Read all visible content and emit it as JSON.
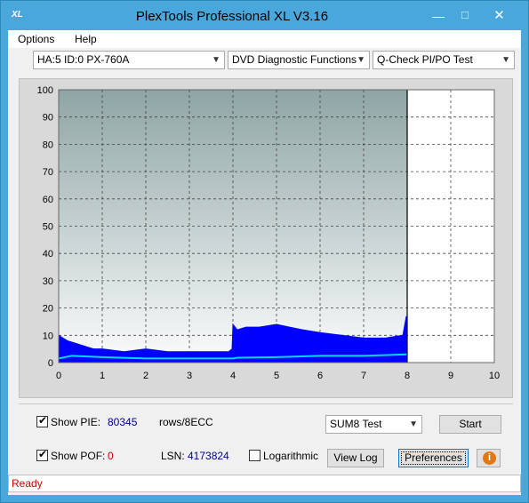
{
  "window": {
    "title": "PlexTools Professional XL V3.16",
    "app_icon_text": "XL",
    "controls": {
      "minimize": "—",
      "maximize": "☐",
      "close": "✕"
    }
  },
  "menu": {
    "options": "Options",
    "help": "Help"
  },
  "selectors": {
    "drive": "HA:5 ID:0  PX-760A",
    "function": "DVD Diagnostic Functions",
    "test": "Q-Check PI/PO Test"
  },
  "chart_data": {
    "type": "area",
    "x_ticks": [
      "0",
      "1",
      "2",
      "3",
      "4",
      "5",
      "6",
      "7",
      "8",
      "9",
      "10"
    ],
    "y_ticks": [
      "0",
      "10",
      "20",
      "30",
      "40",
      "50",
      "60",
      "70",
      "80",
      "90",
      "100"
    ],
    "xlim": [
      0,
      10
    ],
    "ylim": [
      0,
      100
    ],
    "grid": true,
    "marker_x": 8,
    "scanned_until": 8,
    "series": [
      {
        "role": "PIE",
        "color": "#0000ff",
        "x": [
          0,
          0.1,
          0.2,
          0.4,
          0.6,
          0.8,
          1.0,
          1.5,
          2.0,
          2.5,
          3.0,
          3.5,
          3.9,
          3.98,
          4.0,
          4.1,
          4.3,
          4.6,
          5.0,
          5.3,
          5.6,
          6.0,
          6.5,
          7.0,
          7.5,
          7.9,
          7.98
        ],
        "y": [
          10,
          9,
          8,
          7,
          6,
          5,
          5,
          4,
          5,
          4,
          4,
          4,
          4,
          5,
          14,
          12,
          13,
          13,
          14,
          13,
          12,
          11,
          10,
          9,
          9,
          10,
          17
        ]
      },
      {
        "role": "PI total (SUM8)",
        "color": "#00d8ff",
        "x": [
          0,
          0.3,
          1.0,
          2.0,
          3.0,
          4.0,
          4.1,
          5.0,
          6.0,
          7.0,
          8.0
        ],
        "y": [
          1.5,
          2.5,
          2,
          1.5,
          1.5,
          1.5,
          1.8,
          2,
          2.5,
          2.5,
          3
        ]
      }
    ]
  },
  "controls": {
    "show_pie_label": "Show PIE:",
    "show_pie_checked": "✔",
    "pie_value": "80345",
    "rows_label": "rows/8ECC",
    "sum_select": "SUM8 Test",
    "start_button": "Start",
    "show_pof_label": "Show POF:",
    "show_pof_checked": "✔",
    "pof_value": "0",
    "lsn_label": "LSN:",
    "lsn_value": "4173824",
    "log_label": "Logarithmic",
    "view_log_button": "View Log",
    "preferences_button": "Preferences",
    "info_icon_text": "i"
  },
  "status": {
    "text": "Ready"
  }
}
